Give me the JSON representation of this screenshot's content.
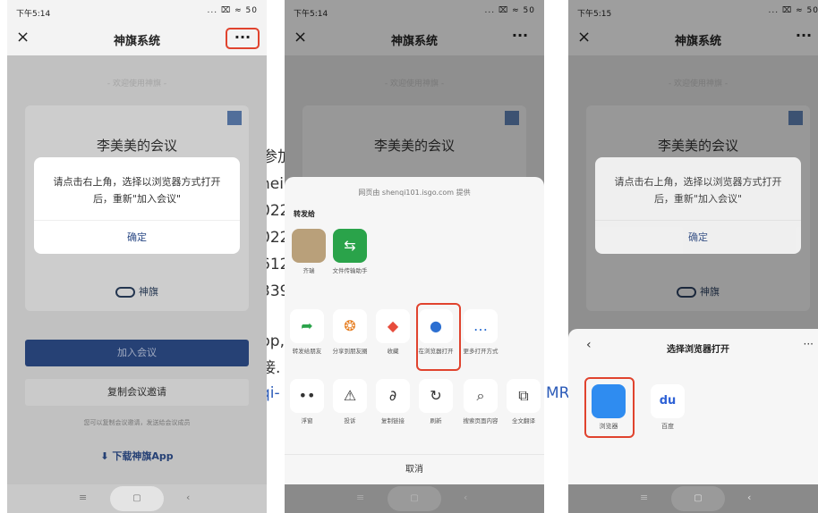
{
  "status": {
    "time1": "下午5:14",
    "time2": "下午5:14",
    "time3": "下午5:15",
    "icons": "... ⌧ ≈ 50"
  },
  "nav": {
    "close": "×",
    "title": "神旗系统",
    "more": "···"
  },
  "welcome": "- 欢迎使用神旗 -",
  "meeting_title": "李美美的会议",
  "dialog": {
    "message": "请点击右上角，选择以浏览器方式打开后，重新\"加入会议\"",
    "ok": "确定"
  },
  "brand": "神旗",
  "join_button": "加入会议",
  "copy_button": "复制会议邀请",
  "copy_hint": "您可以复制会议邀请，发送给会议成员",
  "download": "下载神旗App",
  "navbar": {
    "menu": "≡",
    "home": "▢",
    "back": "‹"
  },
  "share": {
    "provider": "网页由 shenqi101.isgo.com 提供",
    "forward_to": "转发给",
    "contacts": [
      {
        "name": "齐瑞"
      },
      {
        "name": "文件传输助手"
      }
    ],
    "row1": [
      {
        "label": "转发给朋友",
        "icon": "➦"
      },
      {
        "label": "分享到朋友圈",
        "icon": "❂"
      },
      {
        "label": "收藏",
        "icon": "◆"
      },
      {
        "label": "在浏览器打开",
        "icon": "●"
      },
      {
        "label": "更多打开方式",
        "icon": "…"
      }
    ],
    "row2": [
      {
        "label": "浮窗",
        "icon": "••"
      },
      {
        "label": "投诉",
        "icon": "⚠"
      },
      {
        "label": "复制链接",
        "icon": "∂"
      },
      {
        "label": "刷新",
        "icon": "↻"
      },
      {
        "label": "搜索页面内容",
        "icon": "⌕"
      },
      {
        "label": "全文翻译",
        "icon": "⧉"
      }
    ],
    "cancel": "取消"
  },
  "browser": {
    "title": "选择浏览器打开",
    "back": "‹",
    "more": "···",
    "options": [
      {
        "label": "浏览器"
      },
      {
        "label": "百度"
      }
    ]
  },
  "bg": {
    "l1": "参加",
    "l2": "hei",
    "l3": "022",
    "l4": "022",
    "l5": "612",
    "l6": "339",
    "l7": "pp,",
    "l8": "接.",
    "link1": "qi-",
    "link2": "MR"
  }
}
